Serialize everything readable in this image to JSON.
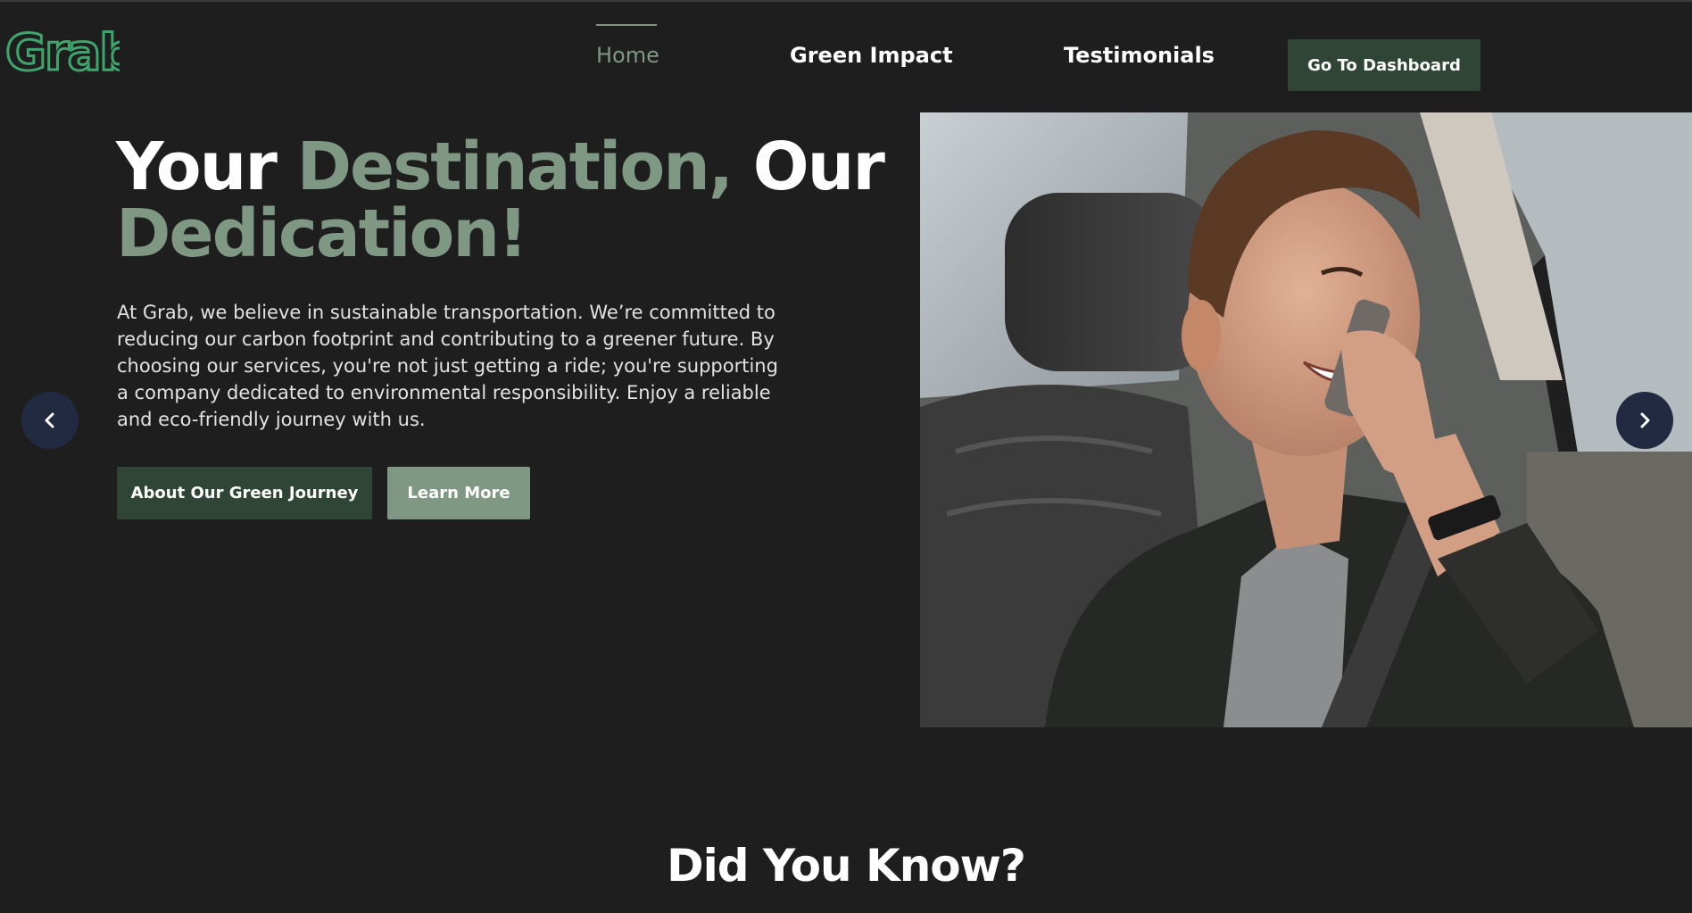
{
  "brand": {
    "logo_text": "Grab",
    "accent_color": "#3ea66b"
  },
  "nav": {
    "items": [
      {
        "label": "Home",
        "active": true
      },
      {
        "label": "Green Impact",
        "active": false
      },
      {
        "label": "Testimonials",
        "active": false
      }
    ],
    "cta_label": "Go To Dashboard"
  },
  "hero": {
    "heading": {
      "word1": "Your ",
      "word2": "Destination,",
      "word3": " Our",
      "word4": "Dedication!"
    },
    "paragraph": "At Grab, we believe in sustainable transportation. We’re committed to reducing our carbon footprint and contributing to a greener future. By choosing our services, you're not just getting a ride; you're supporting a company dedicated to environmental responsibility. Enjoy a reliable and eco-friendly journey with us.",
    "primary_button": "About Our Green Journey",
    "secondary_button": "Learn More",
    "photo_icon": "man-on-phone-in-car-photo"
  },
  "carousel": {
    "prev_icon": "chevron-left-icon",
    "next_icon": "chevron-right-icon"
  },
  "section": {
    "title": "Did You Know?"
  },
  "colors": {
    "background": "#1e1e1e",
    "sage": "#7f9883",
    "dark_green": "#2f4535",
    "arrow_bg": "#222a42"
  }
}
